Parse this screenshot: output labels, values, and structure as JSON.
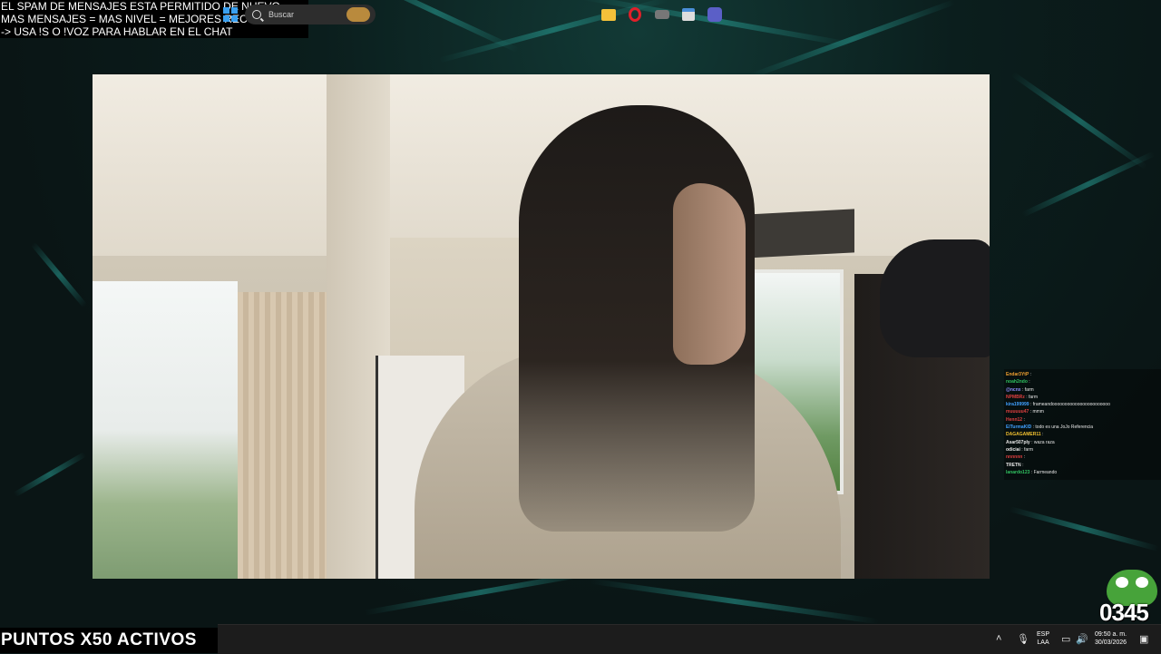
{
  "overlay": {
    "notice_lines": [
      "EL SPAM DE MENSAJES ESTA PERMITIDO DE NUEVO",
      "MAS MENSAJES = MAS NIVEL = MEJORES RECOMPENSAS",
      "-> USA !S  O !VOZ PARA HABLAR EN EL CHAT"
    ],
    "points_banner": "PUNTOS X50 ACTIVOS",
    "mascot_number": "0345"
  },
  "chat": {
    "messages": [
      {
        "user": "Endar3YtP",
        "text": ":",
        "color": "#f0a030"
      },
      {
        "user": "noah2ndo",
        "text": ":",
        "color": "#30c060"
      },
      {
        "user": "@ncnx",
        "text": ": farm",
        "color": "#8f8fff"
      },
      {
        "user": "NPMBRz",
        "text": ": farm",
        "color": "#e04040"
      },
      {
        "user": "kira199999",
        "text": ": frameandooooooooooooooooooooooo",
        "color": "#40a0ff"
      },
      {
        "user": "muuuuu47",
        "text": ": mmm",
        "color": "#e04040"
      },
      {
        "user": "Henn12",
        "text": ":",
        "color": "#e04040"
      },
      {
        "user": "ElTurmaKID",
        "text": ": todo es una JoJo Referencia",
        "color": "#40a0ff"
      },
      {
        "user": "DAGAGAMER11",
        "text": ":",
        "color": "#f0c030"
      },
      {
        "user": "Asar507ply",
        "text": ": waza raza",
        "color": "#e6e6e6"
      },
      {
        "user": "odiciai",
        "text": ": farm",
        "color": "#e6e6e6"
      },
      {
        "user": "nnnnnn",
        "text": ":",
        "color": "#e04040"
      },
      {
        "user": "TRETN",
        "text": ":",
        "color": "#e6e6e6"
      },
      {
        "user": "lanardo123",
        "text": ": Farmeando",
        "color": "#30c060"
      }
    ]
  },
  "taskbar": {
    "search_placeholder": "Buscar",
    "apps": [
      "start-icon",
      "search-box",
      "file-explorer-icon",
      "opera-icon",
      "game-app-icon",
      "calendar-app-icon",
      "teams-icon"
    ],
    "tray": {
      "language_top": "ESP",
      "language_bottom": "LAA",
      "time": "09:50 a. m.",
      "date": "30/03/2026"
    }
  },
  "colors": {
    "accent": "#3aa0f0",
    "taskbar_bg": "#1c1c1c",
    "fern": "#28968c"
  }
}
